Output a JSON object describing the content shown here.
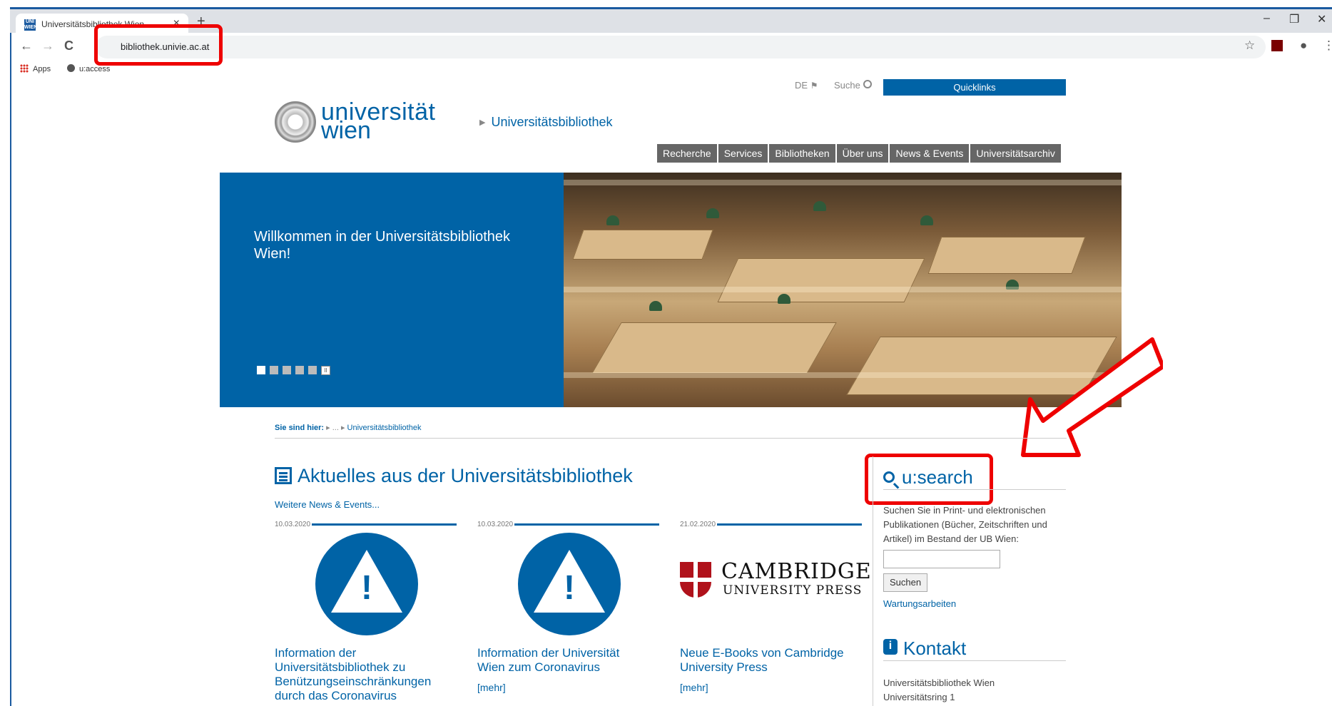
{
  "browser": {
    "tab_title": "Universitätsbibliothek Wien",
    "tab_close": "×",
    "new_tab": "+",
    "favicon_text": "UNI WIEN",
    "url": "bibliothek.univie.ac.at",
    "back": "←",
    "forward": "→",
    "reload": "C",
    "star": "☆",
    "profile": "●",
    "menu": "⋮",
    "minimize": "–",
    "restore": "❐",
    "close": "✕",
    "bookmarks": [
      "Apps",
      "u:access"
    ]
  },
  "header": {
    "lang": "DE",
    "search": "Suche",
    "quicklinks": "Quicklinks",
    "logo_line1": "universität",
    "logo_line2": "wien",
    "site_title": "Universitätsbibliothek",
    "nav": [
      "Recherche",
      "Services",
      "Bibliotheken",
      "Über uns",
      "News & Events",
      "Universitätsarchiv"
    ]
  },
  "hero": {
    "welcome": "Willkommen in der Universitätsbibliothek Wien!"
  },
  "breadcrumb": {
    "label": "Sie sind hier:",
    "sep1": "▸ ... ▸",
    "current": "Universitätsbibliothek"
  },
  "main": {
    "heading": "Aktuelles aus der Universitätsbibliothek",
    "more_news": "Weitere News & Events...",
    "news": [
      {
        "date": "10.03.2020",
        "title": "Information der Universitätsbibliothek zu Benützungseinschränkungen durch das Coronavirus",
        "more": ""
      },
      {
        "date": "10.03.2020",
        "title": "Information der Universität Wien zum Coronavirus",
        "more": "[mehr]"
      },
      {
        "date": "21.02.2020",
        "title": "Neue E-Books von Cambridge University Press",
        "more": "[mehr]",
        "logo1": "CAMBRIDGE",
        "logo2": "UNIVERSITY PRESS"
      }
    ]
  },
  "sidebar": {
    "usearch_heading": "u:search",
    "usearch_text": "Suchen Sie in Print- und elektronischen Publikationen (Bücher, Zeitschriften und Artikel) im Bestand der UB Wien:",
    "search_button": "Suchen",
    "maintenance": "Wartungsarbeiten",
    "kontakt_heading": "Kontakt",
    "kontakt_line1": "Universitätsbibliothek Wien",
    "kontakt_line2": "Universitätsring 1"
  },
  "colors": {
    "brand": "#0063a6",
    "annotation": "#e00000"
  }
}
